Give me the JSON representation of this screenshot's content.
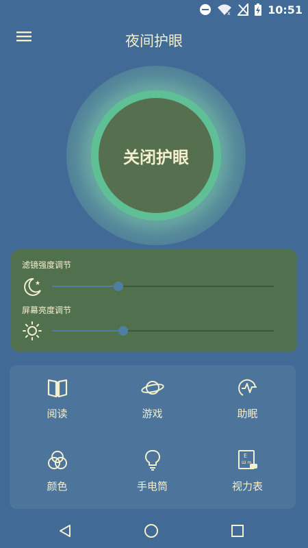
{
  "status_bar": {
    "time": "10:51"
  },
  "app_bar": {
    "title": "夜间护眼"
  },
  "toggle": {
    "label": "关闭护眼"
  },
  "sliders": {
    "filter": {
      "label": "滤镜强度调节",
      "value_percent": 30
    },
    "brightness": {
      "label": "屏幕亮度调节",
      "value_percent": 32
    }
  },
  "grid": {
    "items": [
      {
        "label": "阅读",
        "icon": "book-icon"
      },
      {
        "label": "游戏",
        "icon": "planet-icon"
      },
      {
        "label": "助眠",
        "icon": "sleep-icon"
      },
      {
        "label": "颜色",
        "icon": "color-circles-icon"
      },
      {
        "label": "手电筒",
        "icon": "lightbulb-icon"
      },
      {
        "label": "视力表",
        "icon": "eye-chart-icon"
      }
    ]
  },
  "colors": {
    "background": "#416a96",
    "panel_green": "#51704e",
    "accent_ring": "#5fbf95",
    "text": "#f3f0cf"
  }
}
